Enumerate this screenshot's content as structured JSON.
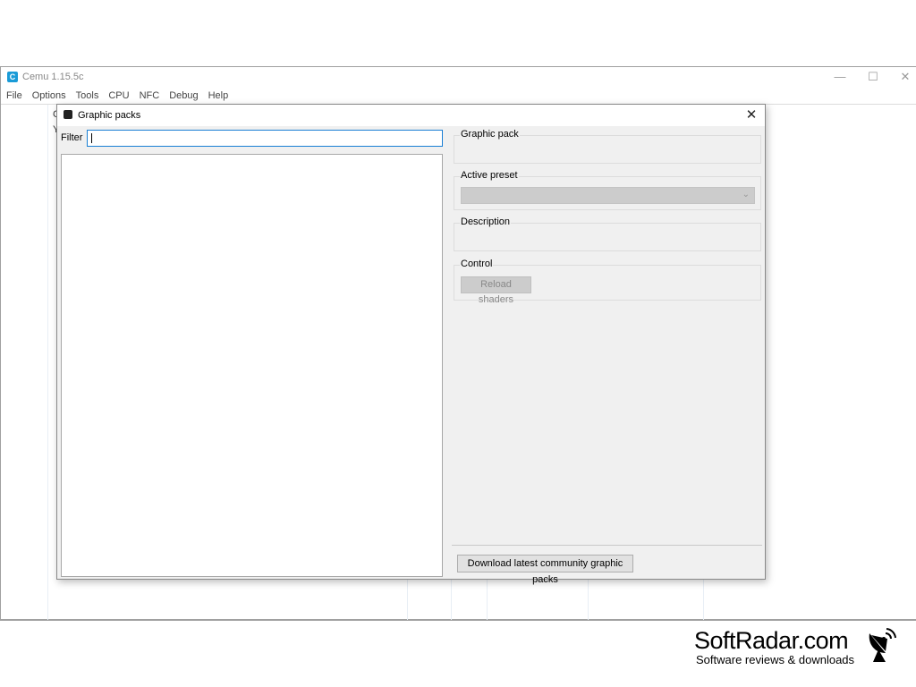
{
  "main_window": {
    "title": "Cemu 1.15.5c",
    "app_icon_letter": "C",
    "icon_color": "#1a9bd7",
    "controls": {
      "minimize": "—",
      "maximize": "☐",
      "close": "✕"
    },
    "menu": [
      "File",
      "Options",
      "Tools",
      "CPU",
      "NFC",
      "Debug",
      "Help"
    ],
    "background_partial_text": [
      "G",
      "Y"
    ]
  },
  "dialog": {
    "title": "Graphic packs",
    "close_glyph": "✕",
    "filter": {
      "label": "Filter",
      "value": "",
      "placeholder": ""
    },
    "pack_list": [],
    "groups": {
      "graphic_pack": {
        "label": "Graphic pack"
      },
      "active_preset": {
        "label": "Active preset",
        "selected": "",
        "chevron": "⌄"
      },
      "description": {
        "label": "Description"
      },
      "control": {
        "label": "Control",
        "reload_button": "Reload shaders"
      }
    },
    "download_button": "Download latest community graphic packs",
    "focus_color": "#1a7fd4"
  },
  "watermark": {
    "name": "SoftRadar.com",
    "tagline": "Software reviews & downloads"
  }
}
